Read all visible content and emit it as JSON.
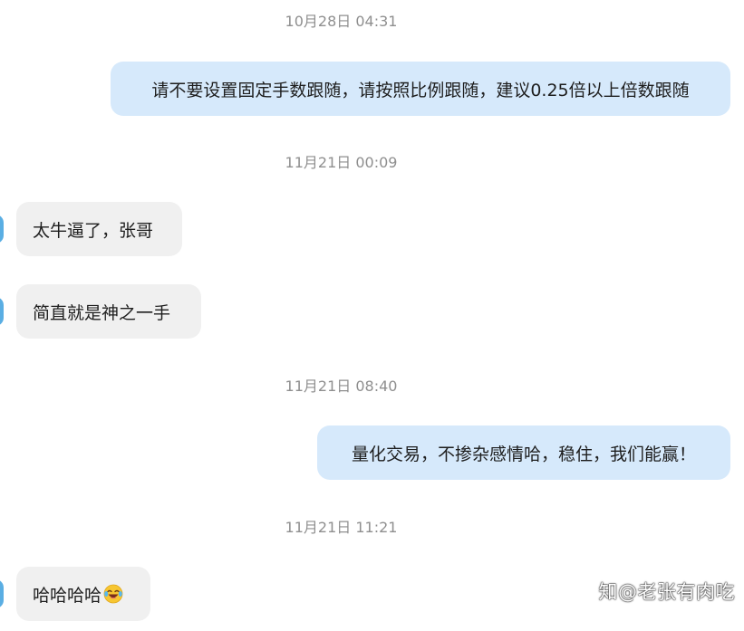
{
  "timestamps": {
    "t1": "10月28日 04:31",
    "t2": "11月21日 00:09",
    "t3": "11月21日 08:40",
    "t4": "11月21日 11:21"
  },
  "messages": {
    "m1": "请不要设置固定手数跟随，请按照比例跟随，建议0.25倍以上倍数跟随",
    "m2": "太牛逼了，张哥",
    "m3": "简直就是神之一手",
    "m4": "量化交易，不掺杂感情哈，稳住，我们能赢！",
    "m5": "哈哈哈哈"
  },
  "emoji": {
    "m5": "laughing-tears-icon"
  },
  "watermark": "知@老张有肉吃",
  "colors": {
    "outgoing_bubble": "#d6e9fb",
    "incoming_bubble": "#f0f0f0",
    "timestamp_text": "#8f8f8f",
    "avatar": "#5aaee3"
  }
}
